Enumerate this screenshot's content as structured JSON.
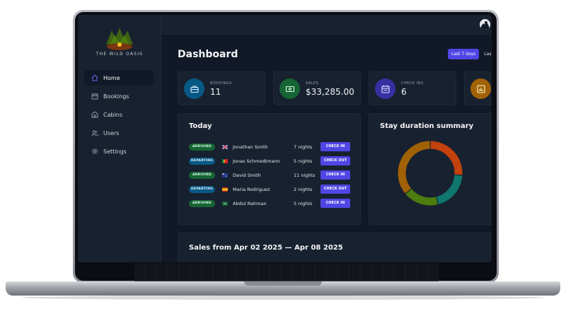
{
  "brand": {
    "name": "THE WILD OASIS"
  },
  "sidebar": {
    "items": [
      {
        "label": "Home",
        "icon": "home-icon",
        "active": true
      },
      {
        "label": "Bookings",
        "icon": "calendar-icon",
        "active": false
      },
      {
        "label": "Cabins",
        "icon": "house-icon",
        "active": false
      },
      {
        "label": "Users",
        "icon": "users-icon",
        "active": false
      },
      {
        "label": "Settings",
        "icon": "gear-icon",
        "active": false
      }
    ]
  },
  "header": {
    "title": "Dashboard"
  },
  "filters": {
    "active": "Last 7 days",
    "next": "Last"
  },
  "stats": [
    {
      "label": "BOOKINGS",
      "value": "11",
      "color": "#075985",
      "icon": "briefcase-icon"
    },
    {
      "label": "SALES",
      "value": "$33,285.00",
      "color": "#166534",
      "icon": "banknote-icon"
    },
    {
      "label": "CHECK INS",
      "value": "6",
      "color": "#3730a3",
      "icon": "calendar-icon"
    },
    {
      "label": "",
      "value": "",
      "color": "#a16207",
      "icon": "chart-icon"
    }
  ],
  "today": {
    "title": "Today",
    "rows": [
      {
        "status": "ARRIVING",
        "guest": "Jonathan Smith",
        "nights": "7 nights",
        "action": "CHECK IN"
      },
      {
        "status": "DEPARTING",
        "guest": "Jonas Schmedtmann",
        "nights": "5 nights",
        "action": "CHECK OUT"
      },
      {
        "status": "ARRIVING",
        "guest": "David Smith",
        "nights": "11 nights",
        "action": "CHECK IN"
      },
      {
        "status": "DEPARTING",
        "guest": "Maria Rodriguez",
        "nights": "2 nights",
        "action": "CHECK OUT"
      },
      {
        "status": "ARRIVING",
        "guest": "Abdul Rahman",
        "nights": "5 nights",
        "action": "CHECK IN"
      }
    ]
  },
  "duration": {
    "title": "Stay duration summary",
    "segments": [
      {
        "color": "#c2410c",
        "fraction": 0.26
      },
      {
        "color": "#0f766e",
        "fraction": 0.2
      },
      {
        "color": "#4d7c0f",
        "fraction": 0.18
      },
      {
        "color": "#a16207",
        "fraction": 0.36
      }
    ]
  },
  "sales": {
    "title": "Sales from Apr 02 2025 — Apr 08 2025"
  },
  "colors": {
    "accent": "#4f46e5",
    "panel": "#18212f",
    "bg": "#111827"
  }
}
